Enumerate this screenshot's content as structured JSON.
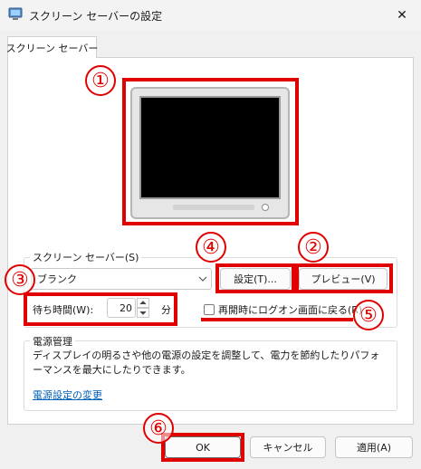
{
  "window": {
    "title": "スクリーン セーバーの設定",
    "close_glyph": "✕"
  },
  "tabs": [
    {
      "label": "スクリーン セーバー"
    }
  ],
  "screensaver": {
    "group_label": "スクリーン セーバー(S)",
    "selected": "ブランク",
    "settings_button": "設定(T)...",
    "preview_button": "プレビュー(V)"
  },
  "wait": {
    "label": "待ち時間(W):",
    "value": "20",
    "unit": "分"
  },
  "resume": {
    "label": "再開時にログオン画面に戻る(R)",
    "checked": false
  },
  "power": {
    "title": "電源管理",
    "description": "ディスプレイの明るさや他の電源の設定を調整して、電力を節約したりパフォーマンスを最大にしたりできます。",
    "link": "電源設定の変更"
  },
  "footer": {
    "ok": "OK",
    "cancel": "キャンセル",
    "apply": "適用(A)"
  },
  "annotations": {
    "color": "#e00000",
    "labels": [
      "①",
      "②",
      "③",
      "④",
      "⑤",
      "⑥"
    ]
  }
}
